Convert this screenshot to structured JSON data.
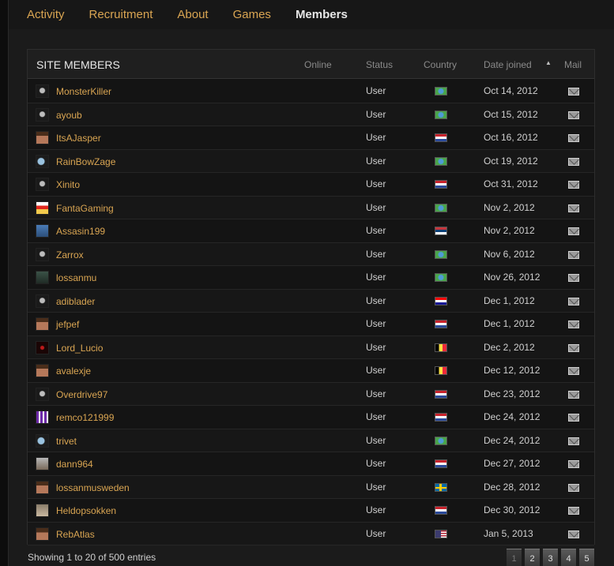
{
  "nav": {
    "items": [
      {
        "label": "Activity"
      },
      {
        "label": "Recruitment"
      },
      {
        "label": "About"
      },
      {
        "label": "Games"
      },
      {
        "label": "Members"
      }
    ],
    "active": "Members"
  },
  "table": {
    "title": "SITE MEMBERS",
    "columns": {
      "online": "Online",
      "status": "Status",
      "country": "Country",
      "date_joined": "Date joined",
      "mail": "Mail"
    },
    "rows": [
      {
        "username": "MonsterKiller",
        "status": "User",
        "country": "world",
        "date": "Oct 14, 2012",
        "avatar": "skull"
      },
      {
        "username": "ayoub",
        "status": "User",
        "country": "world",
        "date": "Oct 15, 2012",
        "avatar": "skull"
      },
      {
        "username": "ItsAJasper",
        "status": "User",
        "country": "nl",
        "date": "Oct 16, 2012",
        "avatar": "steve"
      },
      {
        "username": "RainBowZage",
        "status": "User",
        "country": "world",
        "date": "Oct 19, 2012",
        "avatar": "blue"
      },
      {
        "username": "Xinito",
        "status": "User",
        "country": "nl",
        "date": "Oct 31, 2012",
        "avatar": "skull"
      },
      {
        "username": "FantaGaming",
        "status": "User",
        "country": "world",
        "date": "Nov 2, 2012",
        "avatar": "red"
      },
      {
        "username": "Assasin199",
        "status": "User",
        "country": "rs",
        "date": "Nov 2, 2012",
        "avatar": "sky"
      },
      {
        "username": "Zarrox",
        "status": "User",
        "country": "world",
        "date": "Nov 6, 2012",
        "avatar": "skull"
      },
      {
        "username": "lossanmu",
        "status": "User",
        "country": "world",
        "date": "Nov 26, 2012",
        "avatar": "dark"
      },
      {
        "username": "adiblader",
        "status": "User",
        "country": "hr",
        "date": "Dec 1, 2012",
        "avatar": "skull"
      },
      {
        "username": "jefpef",
        "status": "User",
        "country": "nl",
        "date": "Dec 1, 2012",
        "avatar": "steve"
      },
      {
        "username": "Lord_Lucio",
        "status": "User",
        "country": "be",
        "date": "Dec 2, 2012",
        "avatar": "lucio"
      },
      {
        "username": "avalexje",
        "status": "User",
        "country": "be",
        "date": "Dec 12, 2012",
        "avatar": "steve"
      },
      {
        "username": "Overdrive97",
        "status": "User",
        "country": "nl",
        "date": "Dec 23, 2012",
        "avatar": "skull"
      },
      {
        "username": "remco121999",
        "status": "User",
        "country": "nl",
        "date": "Dec 24, 2012",
        "avatar": "purple"
      },
      {
        "username": "trivet",
        "status": "User",
        "country": "world",
        "date": "Dec 24, 2012",
        "avatar": "blue"
      },
      {
        "username": "dann964",
        "status": "User",
        "country": "nl",
        "date": "Dec 27, 2012",
        "avatar": "gray"
      },
      {
        "username": "lossanmusweden",
        "status": "User",
        "country": "se",
        "date": "Dec 28, 2012",
        "avatar": "steve"
      },
      {
        "username": "Heldopsokken",
        "status": "User",
        "country": "nl",
        "date": "Dec 30, 2012",
        "avatar": "face"
      },
      {
        "username": "RebAtlas",
        "status": "User",
        "country": "us",
        "date": "Jan 5, 2013",
        "avatar": "steve"
      }
    ]
  },
  "footer": {
    "info": "Showing 1 to 20 of 500 entries",
    "pages": [
      "1",
      "2",
      "3",
      "4",
      "5"
    ],
    "current_page": "1"
  },
  "icons": {
    "mail": "mail-icon",
    "sort": "sort-ascending-icon"
  }
}
